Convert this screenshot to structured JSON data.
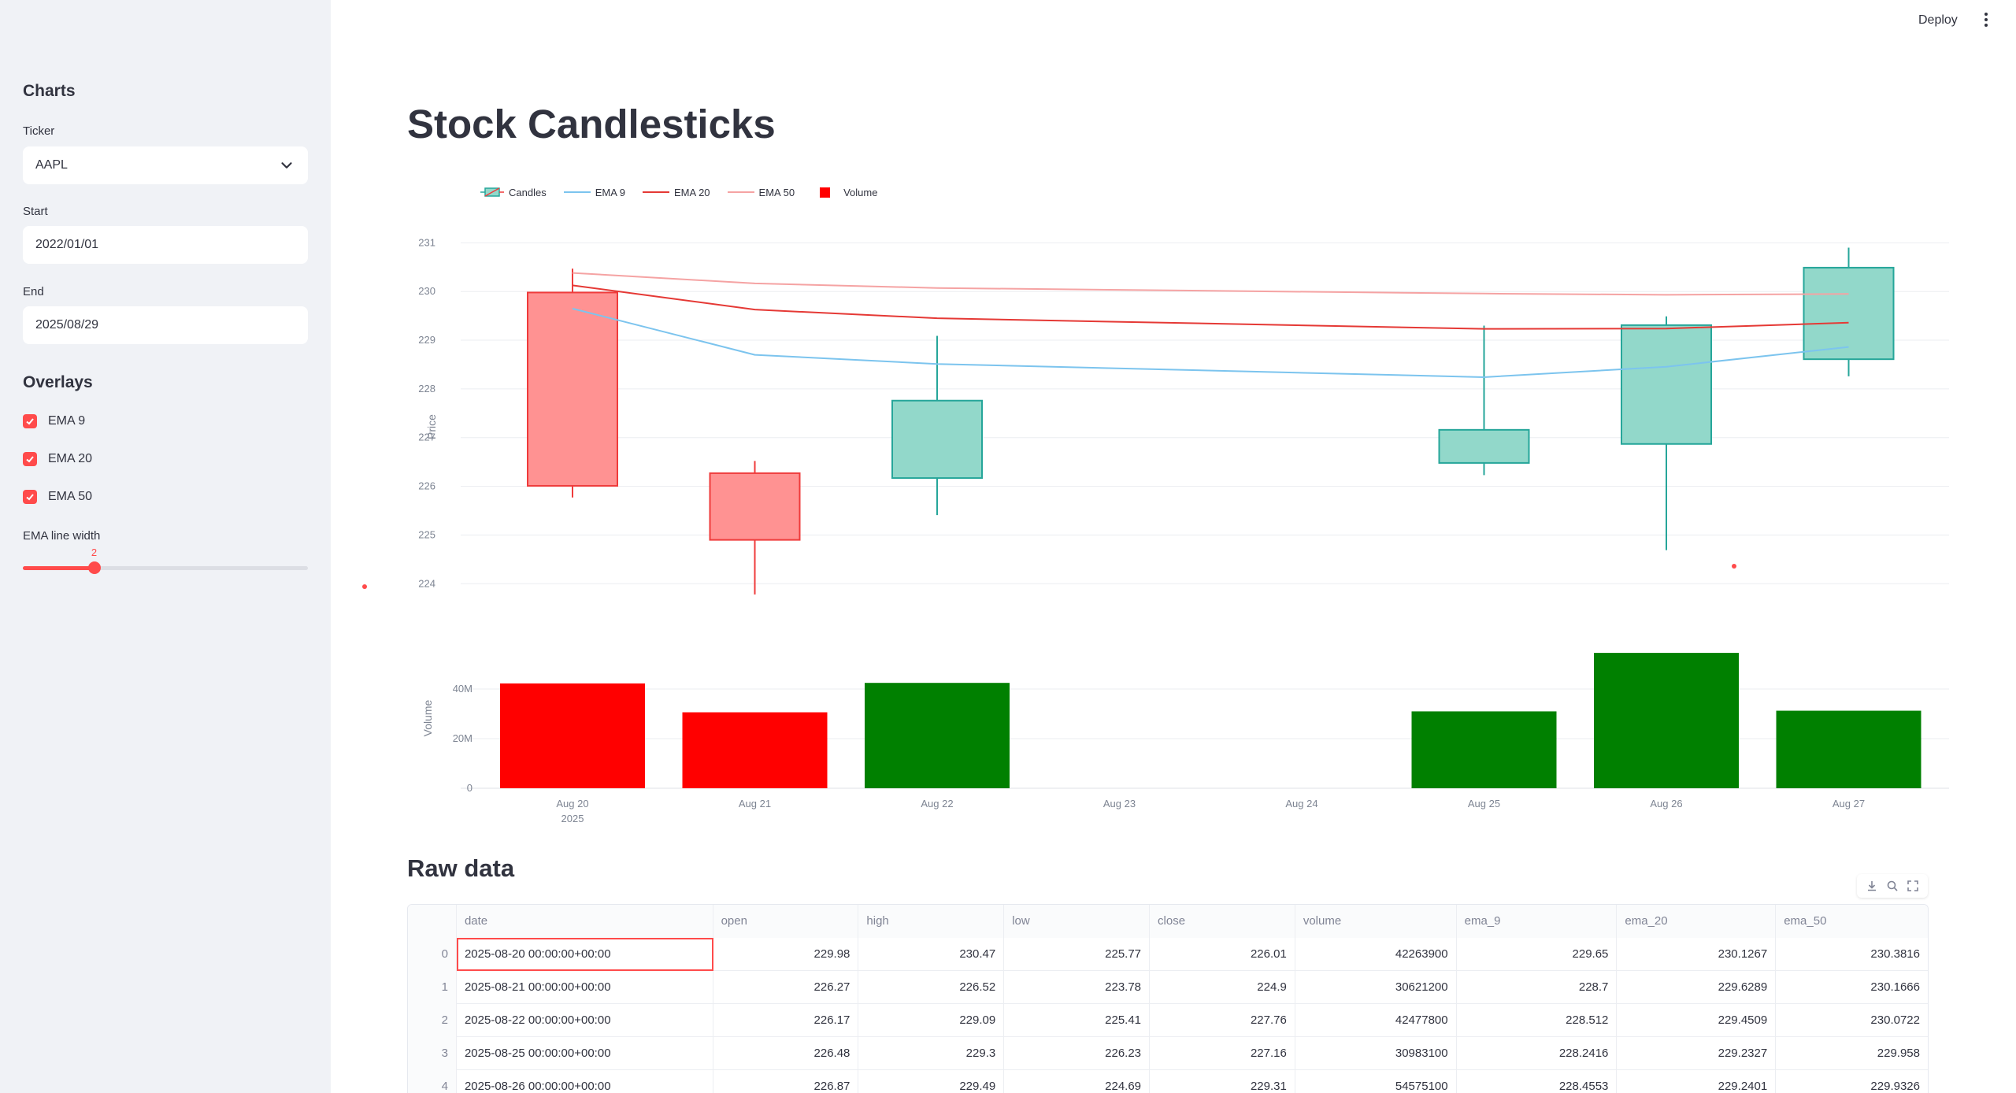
{
  "header": {
    "deploy_label": "Deploy"
  },
  "sidebar": {
    "title": "Charts",
    "ticker_label": "Ticker",
    "ticker_value": "AAPL",
    "start_label": "Start",
    "start_value": "2022/01/01",
    "end_label": "End",
    "end_value": "2025/08/29",
    "overlays_title": "Overlays",
    "overlays": [
      {
        "label": "EMA 9",
        "checked": true
      },
      {
        "label": "EMA 20",
        "checked": true
      },
      {
        "label": "EMA 50",
        "checked": true
      }
    ],
    "slider_label": "EMA line width",
    "slider_value": "2",
    "slider_min": 1,
    "slider_max": 5
  },
  "main": {
    "title": "Stock Candlesticks",
    "raw_title": "Raw data"
  },
  "colors": {
    "accent": "#ff4b4b",
    "candle_up_fill": "#92d8ca",
    "candle_up_line": "#26a69a",
    "candle_down_fill": "#ff9292",
    "candle_down_line": "#ef3b3b",
    "ema9": "#7cc4ee",
    "ema20": "#e53935",
    "ema50": "#f5a3a3",
    "vol_up": "#008000",
    "vol_down": "#ff0000"
  },
  "chart_data": {
    "type": "candlestick",
    "legend": [
      "Candles",
      "EMA 9",
      "EMA 20",
      "EMA 50",
      "Volume"
    ],
    "legend_position": "top-left",
    "ylabel": "Price",
    "ylabel_volume": "Volume",
    "price_ticks": [
      224,
      225,
      226,
      227,
      228,
      229,
      230,
      231
    ],
    "volume_ticks": [
      "0",
      "20M",
      "40M"
    ],
    "ylim": [
      223.6,
      231.2
    ],
    "ylim_volume": [
      0,
      60000000
    ],
    "x_ticks": [
      "Aug 20",
      "Aug 21",
      "Aug 22",
      "Aug 23",
      "Aug 24",
      "Aug 25",
      "Aug 26",
      "Aug 27"
    ],
    "x_year": "2025",
    "grid": true,
    "candles": [
      {
        "date": "Aug 20",
        "open": 229.98,
        "high": 230.47,
        "low": 225.77,
        "close": 226.01,
        "volume": 42263900
      },
      {
        "date": "Aug 21",
        "open": 226.27,
        "high": 226.52,
        "low": 223.78,
        "close": 224.9,
        "volume": 30621200
      },
      {
        "date": "Aug 22",
        "open": 226.17,
        "high": 229.09,
        "low": 225.41,
        "close": 227.76,
        "volume": 42477800
      },
      {
        "date": "Aug 25",
        "open": 226.48,
        "high": 229.3,
        "low": 226.23,
        "close": 227.16,
        "volume": 30983100
      },
      {
        "date": "Aug 26",
        "open": 226.87,
        "high": 229.49,
        "low": 224.69,
        "close": 229.31,
        "volume": 54575100
      },
      {
        "date": "Aug 27",
        "open": 228.61,
        "high": 230.9,
        "low": 228.26,
        "close": 230.49,
        "volume": 31259500
      }
    ],
    "series": [
      {
        "name": "EMA 9",
        "x": [
          "Aug 20",
          "Aug 21",
          "Aug 22",
          "Aug 25",
          "Aug 26",
          "Aug 27"
        ],
        "values": [
          229.65,
          228.7,
          228.512,
          228.2416,
          228.4553,
          228.862
        ]
      },
      {
        "name": "EMA 20",
        "x": [
          "Aug 20",
          "Aug 21",
          "Aug 22",
          "Aug 25",
          "Aug 26",
          "Aug 27"
        ],
        "values": [
          230.1267,
          229.6289,
          229.4509,
          229.2327,
          229.2401,
          229.36
        ]
      },
      {
        "name": "EMA 50",
        "x": [
          "Aug 20",
          "Aug 21",
          "Aug 22",
          "Aug 25",
          "Aug 26",
          "Aug 27"
        ],
        "values": [
          230.3816,
          230.1666,
          230.0722,
          229.958,
          229.9326,
          229.95
        ]
      }
    ]
  },
  "table": {
    "columns": [
      "",
      "date",
      "open",
      "high",
      "low",
      "close",
      "volume",
      "ema_9",
      "ema_20",
      "ema_50"
    ],
    "rows": [
      [
        "0",
        "2025-08-20 00:00:00+00:00",
        "229.98",
        "230.47",
        "225.77",
        "226.01",
        "42263900",
        "229.65",
        "230.1267",
        "230.3816"
      ],
      [
        "1",
        "2025-08-21 00:00:00+00:00",
        "226.27",
        "226.52",
        "223.78",
        "224.9",
        "30621200",
        "228.7",
        "229.6289",
        "230.1666"
      ],
      [
        "2",
        "2025-08-22 00:00:00+00:00",
        "226.17",
        "229.09",
        "225.41",
        "227.76",
        "42477800",
        "228.512",
        "229.4509",
        "230.0722"
      ],
      [
        "3",
        "2025-08-25 00:00:00+00:00",
        "226.48",
        "229.3",
        "226.23",
        "227.16",
        "30983100",
        "228.2416",
        "229.2327",
        "229.958"
      ],
      [
        "4",
        "2025-08-26 00:00:00+00:00",
        "226.87",
        "229.49",
        "224.69",
        "229.31",
        "54575100",
        "228.4553",
        "229.2401",
        "229.9326"
      ]
    ]
  }
}
